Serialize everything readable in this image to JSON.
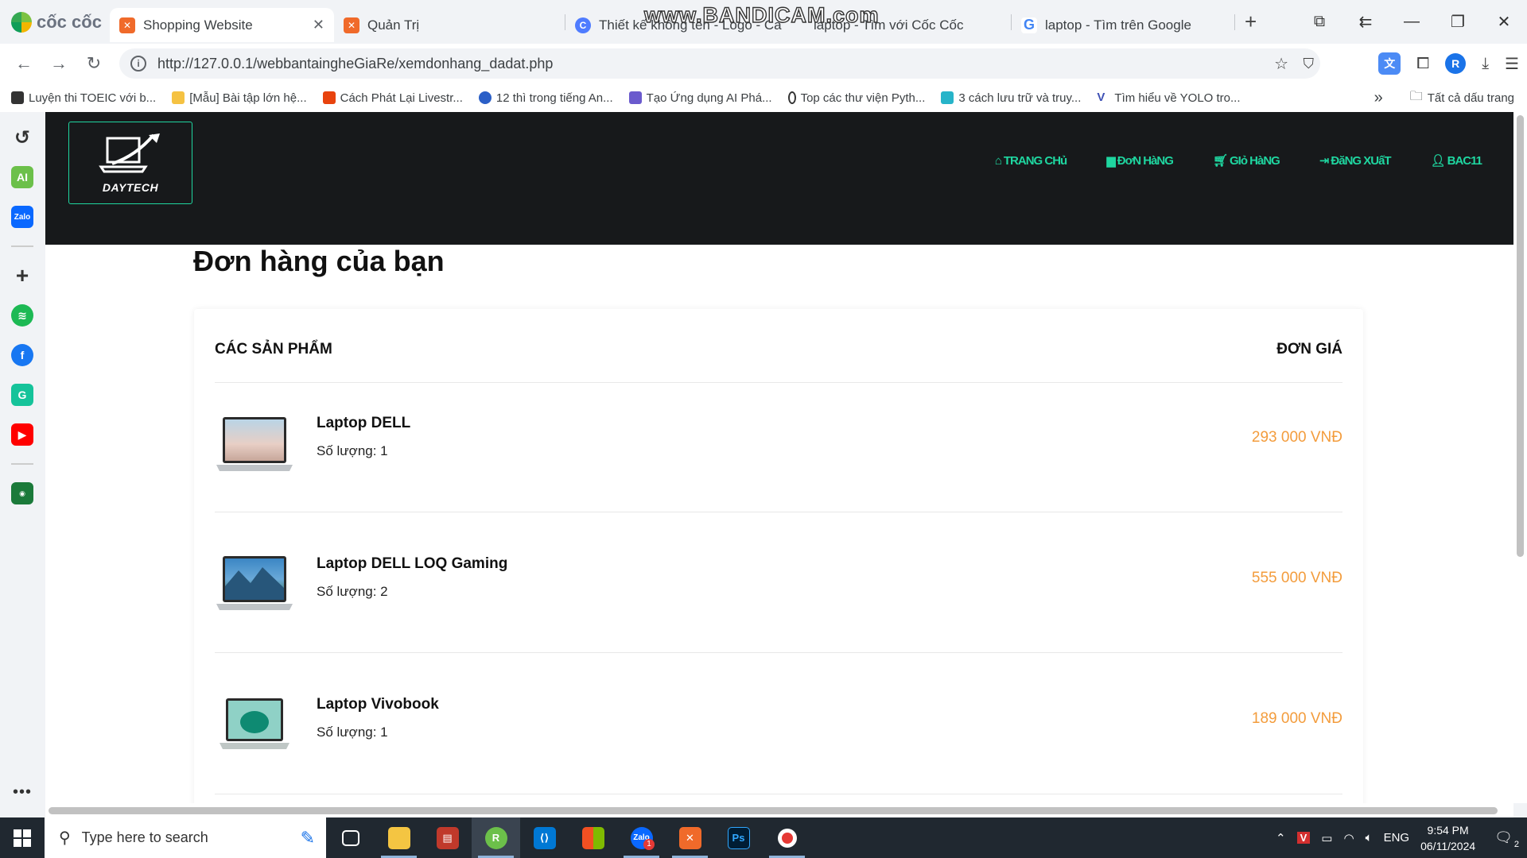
{
  "browser": {
    "brand": "cốc cốc",
    "tabs": [
      {
        "title": "Shopping Website",
        "active": true
      },
      {
        "title": "Quản Trị"
      },
      {
        "title": "Thiết kế không tên - Logo - Car"
      },
      {
        "title": "laptop - Tìm với Cốc Cốc"
      },
      {
        "title": "laptop - Tìm trên Google"
      }
    ],
    "url": "http://127.0.0.1/webbantaingheGiaRe/xemdonhang_dadat.php",
    "profile_initial": "R",
    "watermark": "www.BANDICAM.com",
    "bookmarks": [
      "Luyện thi TOEIC với b...",
      "[Mẫu] Bài tập lớn hệ...",
      "Cách Phát Lại Livestr...",
      "12 thì trong tiếng An...",
      "Tạo Ứng dụng AI Phá...",
      "Top các thư viện Pyth...",
      "3 cách lưu trữ và truy...",
      "Tìm hiểu về YOLO tro..."
    ],
    "all_bookmarks": "Tất cả dấu trang"
  },
  "site": {
    "logo_text": "DAYTECH",
    "menu": [
      "TRANG CHủ",
      "ĐơN HàNG",
      "GIỏ HàNG",
      "ĐăNG XUấT",
      "BAC11"
    ]
  },
  "page": {
    "title": "Đơn hàng của bạn",
    "col_products": "CÁC SẢN PHẨM",
    "col_price": "ĐƠN GIÁ",
    "qty_label": "Số lượng: ",
    "orders": [
      {
        "name": "Laptop DELL",
        "qty": "1",
        "price": "293 000 VNĐ",
        "qty_text": "Số lượng: 1"
      },
      {
        "name": "Laptop DELL LOQ Gaming",
        "qty": "2",
        "price": "555 000 VNĐ",
        "qty_text": "Số lượng: 2"
      },
      {
        "name": "Laptop Vivobook",
        "qty": "1",
        "price": "189 000 VNĐ",
        "qty_text": "Số lượng: 1"
      }
    ]
  },
  "taskbar": {
    "search_placeholder": "Type here to search",
    "lang": "ENG",
    "time": "9:54 PM",
    "date": "06/11/2024",
    "notif_count": "2",
    "zalo_badge": "1"
  },
  "colors": {
    "accent": "#1fd6a0",
    "price": "#f39c3c",
    "header_bg": "#17191b"
  }
}
